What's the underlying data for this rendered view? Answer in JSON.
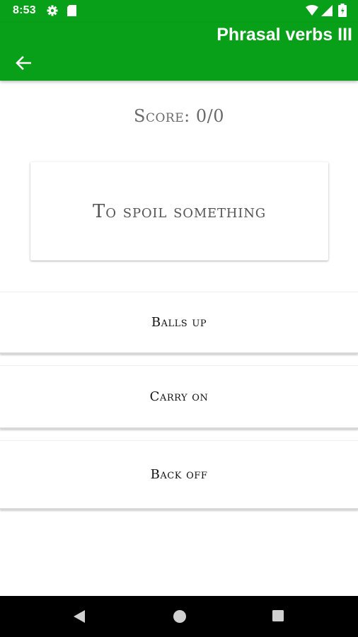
{
  "status_bar": {
    "time": "8:53",
    "icons": [
      "settings-gear-icon",
      "sd-card-icon",
      "wifi-icon",
      "signal-icon",
      "battery-icon"
    ]
  },
  "app_bar": {
    "title": "Phrasal verbs III",
    "back_icon": "arrow-left-icon",
    "color": "#08a018"
  },
  "quiz": {
    "score_label": "Score: 0/0",
    "question": "To spoil something",
    "answers": [
      "Balls up",
      "Carry on",
      "Back off"
    ]
  },
  "nav_bar": {
    "buttons": [
      "back-triangle-icon",
      "home-circle-icon",
      "recents-square-icon"
    ]
  }
}
